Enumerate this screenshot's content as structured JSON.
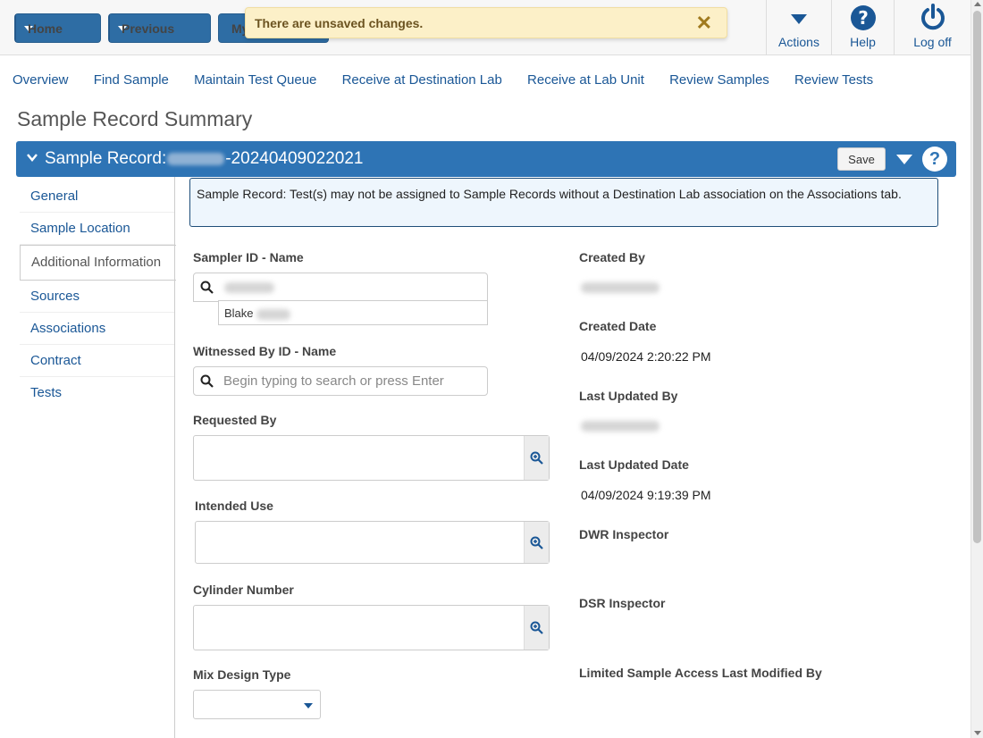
{
  "toolbar": {
    "home_label": "Home",
    "previous_label": "Previous",
    "my_label": "My",
    "actions_label": "Actions",
    "help_label": "Help",
    "logoff_label": "Log off"
  },
  "toast": {
    "message": "There are unsaved changes.",
    "close": "✕"
  },
  "subnav": [
    "Overview",
    "Find Sample",
    "Maintain Test Queue",
    "Receive at Destination Lab",
    "Receive at Lab Unit",
    "Review Samples",
    "Review Tests"
  ],
  "page_title": "Sample Record Summary",
  "record": {
    "prefix": "Sample Record:",
    "id_suffix": "-20240409022021",
    "save_label": "Save",
    "help": "?"
  },
  "tabs": [
    "General",
    "Sample Location",
    "Additional Information",
    "Sources",
    "Associations",
    "Contract",
    "Tests"
  ],
  "alert": "Sample Record: Test(s) may not be assigned to Sample Records without a Destination Lab association on the Associations tab.",
  "form": {
    "sampler_label": "Sampler ID - Name",
    "sampler_suggestion": "Blake",
    "witnessed_label": "Witnessed By ID - Name",
    "witnessed_placeholder": "Begin typing to search or press Enter",
    "requested_label": "Requested By",
    "intended_label": "Intended Use",
    "cylinder_label": "Cylinder Number",
    "mix_label": "Mix Design Type"
  },
  "info": {
    "created_by_label": "Created By",
    "created_date_label": "Created Date",
    "created_date": "04/09/2024 2:20:22 PM",
    "last_updated_by_label": "Last Updated By",
    "last_updated_date_label": "Last Updated Date",
    "last_updated_date": "04/09/2024 9:19:39 PM",
    "dwr_label": "DWR Inspector",
    "dsr_label": "DSR Inspector",
    "limited_label": "Limited Sample Access Last Modified By"
  }
}
